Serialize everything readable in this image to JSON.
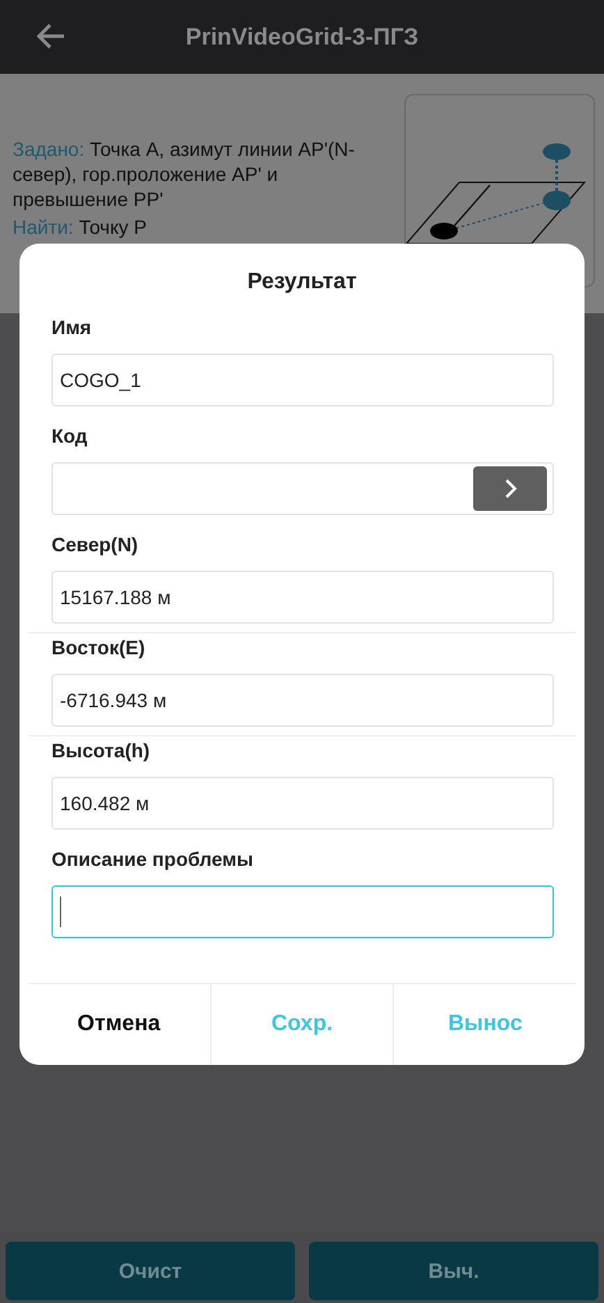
{
  "header": {
    "title": "PrinVideoGrid-3-ПГЗ"
  },
  "problem": {
    "given_label": "Задано:",
    "given_text": "Точка А, азимут линии AP'(N-север), гор.проложение AP' и превышение PP'",
    "find_label": "Найти:",
    "find_text": "Точку P"
  },
  "diagram": {
    "kind": "picture"
  },
  "dialog": {
    "title": "Результат",
    "fields": [
      {
        "label": "Имя",
        "kind": "text",
        "value": "COGO_1",
        "focused": false,
        "separator": false
      },
      {
        "label": "Код",
        "kind": "picker",
        "focused": false,
        "separator": false
      },
      {
        "label": "Север(N)",
        "kind": "text",
        "value": "15167.188 м",
        "focused": false,
        "separator": true
      },
      {
        "label": "Восток(E)",
        "kind": "text",
        "value": "-6716.943 м",
        "focused": false,
        "separator": true
      },
      {
        "label": "Высота(h)",
        "kind": "text",
        "value": "160.482 м",
        "focused": false,
        "separator": false
      },
      {
        "label": "Описание проблемы",
        "kind": "text",
        "focused": true,
        "separator": false
      }
    ],
    "actions": [
      {
        "label": "Отмена",
        "kind": "neutral"
      },
      {
        "label": "Сохр.",
        "kind": "accent"
      },
      {
        "label": "Вынос",
        "kind": "accent"
      }
    ]
  },
  "bottom_buttons": [
    "Очист",
    "Выч."
  ]
}
